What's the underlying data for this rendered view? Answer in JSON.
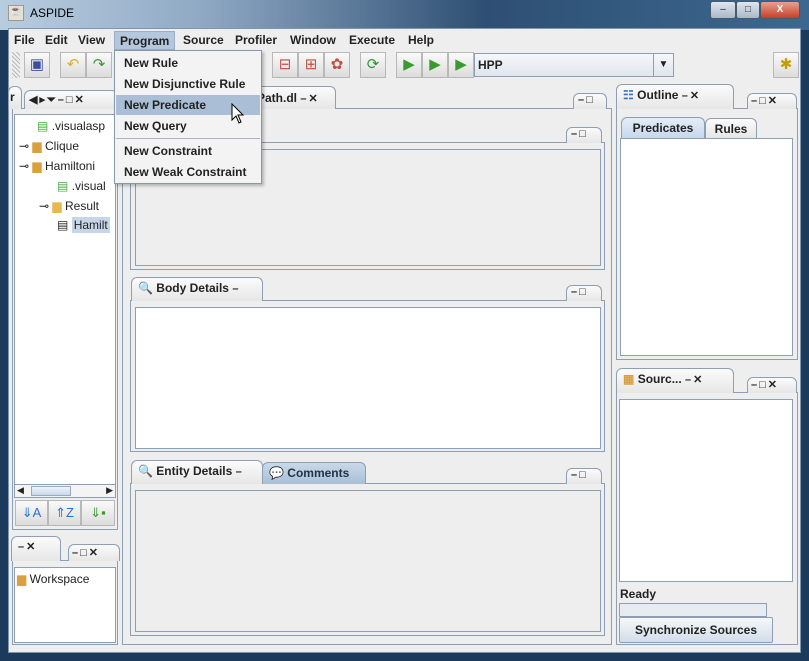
{
  "window": {
    "title": "ASPIDE",
    "minimize": "–",
    "maximize": "□",
    "close": "X"
  },
  "menubar": [
    "File",
    "Edit",
    "View",
    "Program",
    "Source",
    "Profiler",
    "Window",
    "Execute",
    "Help"
  ],
  "program_menu": {
    "items": [
      "New Rule",
      "New Disjunctive Rule",
      "New Predicate",
      "New Query",
      "New Constraint",
      "New Weak Constraint"
    ],
    "highlighted": "New Predicate"
  },
  "toolbar": {
    "run_config": "HPP"
  },
  "left_panel": {
    "tab_label": "r",
    "tree": [
      ".visualasp",
      "Clique",
      "Hamiltoni",
      ".visual",
      "Result",
      "Hamilt"
    ],
    "workspace": "Workspace"
  },
  "editor": {
    "tab_label": "Path.dl",
    "body_details": "Body Details",
    "entity_details": "Entity Details",
    "comments": "Comments"
  },
  "outline": {
    "title": "Outline",
    "tabs": [
      "Predicates",
      "Rules"
    ],
    "active_tab": "Predicates"
  },
  "sources": {
    "title": "Sourc...",
    "status": "Ready",
    "sync_button": "Synchronize Sources"
  },
  "colors": {
    "menu_highlight": "#aabfd6",
    "selection": "#c6d6e8"
  }
}
